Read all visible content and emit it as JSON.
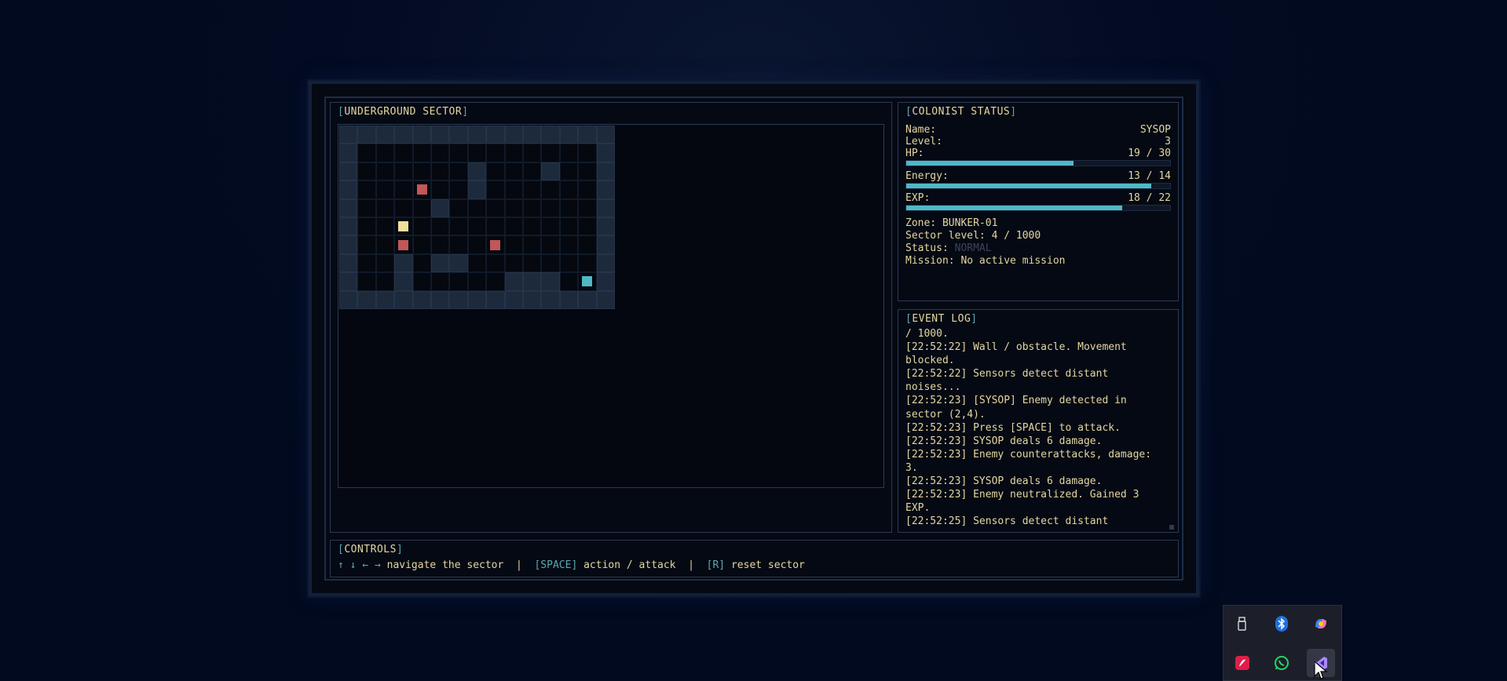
{
  "map_panel": {
    "title": "UNDERGROUND SECTOR"
  },
  "map": {
    "cols": 15,
    "rows": 10,
    "walls": [
      [
        0,
        0
      ],
      [
        1,
        0
      ],
      [
        2,
        0
      ],
      [
        3,
        0
      ],
      [
        4,
        0
      ],
      [
        5,
        0
      ],
      [
        6,
        0
      ],
      [
        7,
        0
      ],
      [
        8,
        0
      ],
      [
        9,
        0
      ],
      [
        10,
        0
      ],
      [
        11,
        0
      ],
      [
        12,
        0
      ],
      [
        13,
        0
      ],
      [
        14,
        0
      ],
      [
        0,
        1
      ],
      [
        14,
        1
      ],
      [
        0,
        2
      ],
      [
        7,
        2
      ],
      [
        11,
        2
      ],
      [
        14,
        2
      ],
      [
        0,
        3
      ],
      [
        7,
        3
      ],
      [
        14,
        3
      ],
      [
        0,
        4
      ],
      [
        5,
        4
      ],
      [
        14,
        4
      ],
      [
        0,
        5
      ],
      [
        14,
        5
      ],
      [
        0,
        6
      ],
      [
        14,
        6
      ],
      [
        0,
        7
      ],
      [
        3,
        7
      ],
      [
        5,
        7
      ],
      [
        6,
        7
      ],
      [
        14,
        7
      ],
      [
        0,
        8
      ],
      [
        3,
        8
      ],
      [
        9,
        8
      ],
      [
        10,
        8
      ],
      [
        11,
        8
      ],
      [
        14,
        8
      ],
      [
        0,
        9
      ],
      [
        1,
        9
      ],
      [
        2,
        9
      ],
      [
        3,
        9
      ],
      [
        4,
        9
      ],
      [
        5,
        9
      ],
      [
        6,
        9
      ],
      [
        7,
        9
      ],
      [
        8,
        9
      ],
      [
        9,
        9
      ],
      [
        10,
        9
      ],
      [
        11,
        9
      ],
      [
        12,
        9
      ],
      [
        13,
        9
      ],
      [
        14,
        9
      ]
    ],
    "entities": [
      {
        "type": "enemy",
        "col": 4,
        "row": 3,
        "color": "#c25658"
      },
      {
        "type": "item",
        "col": 3,
        "row": 5,
        "color": "#f1df9e"
      },
      {
        "type": "enemy",
        "col": 3,
        "row": 6,
        "color": "#c25658"
      },
      {
        "type": "enemy",
        "col": 8,
        "row": 6,
        "color": "#c25658"
      },
      {
        "type": "player",
        "col": 13,
        "row": 8,
        "color": "#4fb8c6"
      }
    ]
  },
  "status": {
    "title": "COLONIST STATUS",
    "name_label": "Name:",
    "name_value": "SYSOP",
    "level_label": "Level:",
    "level_value": "3",
    "hp_label": "HP:",
    "hp_value": "19 / 30",
    "hp_fraction": 0.633,
    "energy_label": "Energy:",
    "energy_value": "13 / 14",
    "energy_fraction": 0.929,
    "exp_label": "EXP:",
    "exp_value": "18 / 22",
    "exp_fraction": 0.818,
    "zone": "Zone: BUNKER-01",
    "sector_level": "Sector level: 4 / 1000",
    "status_label": "Status:",
    "status_value": "NORMAL",
    "mission": "Mission: No active mission"
  },
  "log": {
    "title": "EVENT LOG",
    "lines": [
      "/ 1000.",
      "[22:52:22] Wall / obstacle. Movement blocked.",
      "[22:52:22] Sensors detect distant noises...",
      "[22:52:23] [SYSOP] Enemy detected in sector (2,4).",
      "[22:52:23] Press [SPACE] to attack.",
      "[22:52:23] SYSOP deals 6 damage.",
      "[22:52:23] Enemy counterattacks, damage: 3.",
      "[22:52:23] SYSOP deals 6 damage.",
      "[22:52:23] Enemy neutralized. Gained 3 EXP.",
      "[22:52:25] Sensors detect distant"
    ]
  },
  "controls": {
    "title": "CONTROLS",
    "arrows": "↑ ↓ ← →",
    "navigate": "navigate the sector",
    "sep": "|",
    "space_key": "[SPACE]",
    "space_action": "action / attack",
    "reset_key": "[R]",
    "reset_action": "reset sector"
  },
  "tray": {
    "icons": [
      "usb-drive-icon",
      "bluetooth-icon",
      "copilot-icon",
      "red-app-icon",
      "whatsapp-icon",
      "visual-studio-icon"
    ]
  }
}
